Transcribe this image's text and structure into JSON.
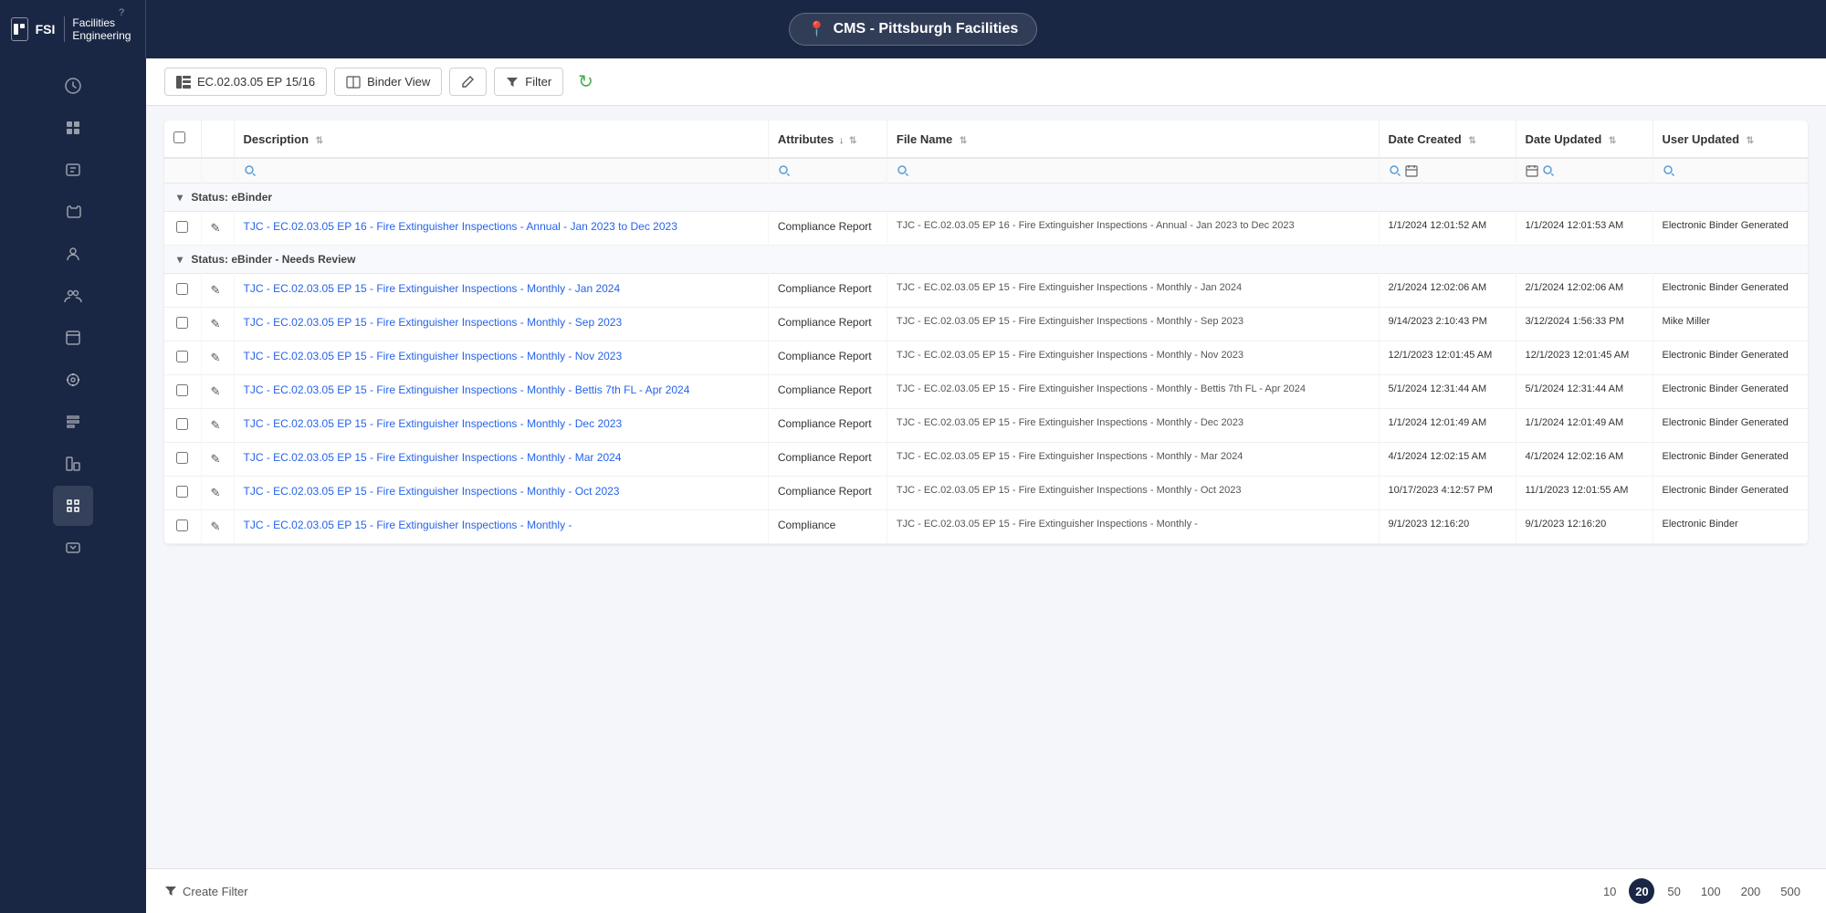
{
  "app": {
    "logo_text": "FSI",
    "app_name": "Facilities Engineering",
    "location_icon": "📍",
    "location_label": "CMS - Pittsburgh Facilities"
  },
  "toolbar": {
    "binder_label": "EC.02.03.05 EP 15/16",
    "binder_view_label": "Binder View",
    "filter_label": "Filter",
    "refresh_icon": "↻"
  },
  "table": {
    "columns": [
      {
        "id": "checkbox",
        "label": ""
      },
      {
        "id": "edit",
        "label": ""
      },
      {
        "id": "description",
        "label": "Description",
        "filter": true
      },
      {
        "id": "attributes",
        "label": "Attributes",
        "filter": true,
        "sort": "↓"
      },
      {
        "id": "filename",
        "label": "File Name",
        "filter": true
      },
      {
        "id": "date_created",
        "label": "Date Created",
        "filter": true
      },
      {
        "id": "date_updated",
        "label": "Date Updated",
        "filter": true
      },
      {
        "id": "user_updated",
        "label": "User Updated",
        "filter": true
      }
    ],
    "groups": [
      {
        "label": "Status: eBinder",
        "rows": [
          {
            "description": "TJC - EC.02.03.05 EP 16 - Fire Extinguisher Inspections - Annual - Jan 2023 to Dec 2023",
            "attributes": "Compliance Report",
            "filename": "TJC - EC.02.03.05 EP 16 - Fire Extinguisher Inspections - Annual - Jan 2023 to Dec 2023",
            "date_created": "1/1/2024 12:01:52 AM",
            "date_updated": "1/1/2024 12:01:53 AM",
            "user_updated": "Electronic Binder Generated"
          }
        ]
      },
      {
        "label": "Status: eBinder - Needs Review",
        "rows": [
          {
            "description": "TJC - EC.02.03.05 EP 15 - Fire Extinguisher Inspections - Monthly - Jan 2024",
            "attributes": "Compliance Report",
            "filename": "TJC - EC.02.03.05 EP 15 - Fire Extinguisher Inspections - Monthly - Jan 2024",
            "date_created": "2/1/2024 12:02:06 AM",
            "date_updated": "2/1/2024 12:02:06 AM",
            "user_updated": "Electronic Binder Generated"
          },
          {
            "description": "TJC - EC.02.03.05 EP 15 - Fire Extinguisher Inspections - Monthly - Sep 2023",
            "attributes": "Compliance Report",
            "filename": "TJC - EC.02.03.05 EP 15 - Fire Extinguisher Inspections - Monthly - Sep 2023",
            "date_created": "9/14/2023 2:10:43 PM",
            "date_updated": "3/12/2024 1:56:33 PM",
            "user_updated": "Mike Miller"
          },
          {
            "description": "TJC - EC.02.03.05 EP 15 - Fire Extinguisher Inspections - Monthly - Nov 2023",
            "attributes": "Compliance Report",
            "filename": "TJC - EC.02.03.05 EP 15 - Fire Extinguisher Inspections - Monthly - Nov 2023",
            "date_created": "12/1/2023 12:01:45 AM",
            "date_updated": "12/1/2023 12:01:45 AM",
            "user_updated": "Electronic Binder Generated"
          },
          {
            "description": "TJC - EC.02.03.05 EP 15 - Fire Extinguisher Inspections - Monthly - Bettis 7th FL - Apr 2024",
            "attributes": "Compliance Report",
            "filename": "TJC - EC.02.03.05 EP 15 - Fire Extinguisher Inspections - Monthly - Bettis 7th FL - Apr 2024",
            "date_created": "5/1/2024 12:31:44 AM",
            "date_updated": "5/1/2024 12:31:44 AM",
            "user_updated": "Electronic Binder Generated"
          },
          {
            "description": "TJC - EC.02.03.05 EP 15 - Fire Extinguisher Inspections - Monthly - Dec 2023",
            "attributes": "Compliance Report",
            "filename": "TJC - EC.02.03.05 EP 15 - Fire Extinguisher Inspections - Monthly - Dec 2023",
            "date_created": "1/1/2024 12:01:49 AM",
            "date_updated": "1/1/2024 12:01:49 AM",
            "user_updated": "Electronic Binder Generated"
          },
          {
            "description": "TJC - EC.02.03.05 EP 15 - Fire Extinguisher Inspections - Monthly - Mar 2024",
            "attributes": "Compliance Report",
            "filename": "TJC - EC.02.03.05 EP 15 - Fire Extinguisher Inspections - Monthly - Mar 2024",
            "date_created": "4/1/2024 12:02:15 AM",
            "date_updated": "4/1/2024 12:02:16 AM",
            "user_updated": "Electronic Binder Generated"
          },
          {
            "description": "TJC - EC.02.03.05 EP 15 - Fire Extinguisher Inspections - Monthly - Oct 2023",
            "attributes": "Compliance Report",
            "filename": "TJC - EC.02.03.05 EP 15 - Fire Extinguisher Inspections - Monthly - Oct 2023",
            "date_created": "10/17/2023 4:12:57 PM",
            "date_updated": "11/1/2023 12:01:55 AM",
            "user_updated": "Electronic Binder Generated"
          },
          {
            "description": "TJC - EC.02.03.05 EP 15 - Fire Extinguisher Inspections - Monthly -",
            "attributes": "Compliance",
            "filename": "TJC - EC.02.03.05 EP 15 - Fire Extinguisher Inspections - Monthly -",
            "date_created": "9/1/2023 12:16:20",
            "date_updated": "9/1/2023 12:16:20",
            "user_updated": "Electronic Binder"
          }
        ]
      }
    ]
  },
  "bottom": {
    "create_filter_label": "Create Filter",
    "pagination": {
      "sizes": [
        "10",
        "20",
        "50",
        "100",
        "200",
        "500"
      ],
      "active": "20"
    }
  },
  "sidebar": {
    "items": [
      {
        "icon": "🏠",
        "name": "home"
      },
      {
        "icon": "📊",
        "name": "dashboard"
      },
      {
        "icon": "📋",
        "name": "reports"
      },
      {
        "icon": "🗂️",
        "name": "files"
      },
      {
        "icon": "👤",
        "name": "profile"
      },
      {
        "icon": "👥",
        "name": "users"
      },
      {
        "icon": "📦",
        "name": "inventory"
      },
      {
        "icon": "🛒",
        "name": "cart"
      },
      {
        "icon": "📄",
        "name": "documents"
      },
      {
        "icon": "📈",
        "name": "analytics"
      },
      {
        "icon": "📁",
        "name": "folder"
      },
      {
        "icon": "🖼️",
        "name": "images"
      }
    ]
  }
}
